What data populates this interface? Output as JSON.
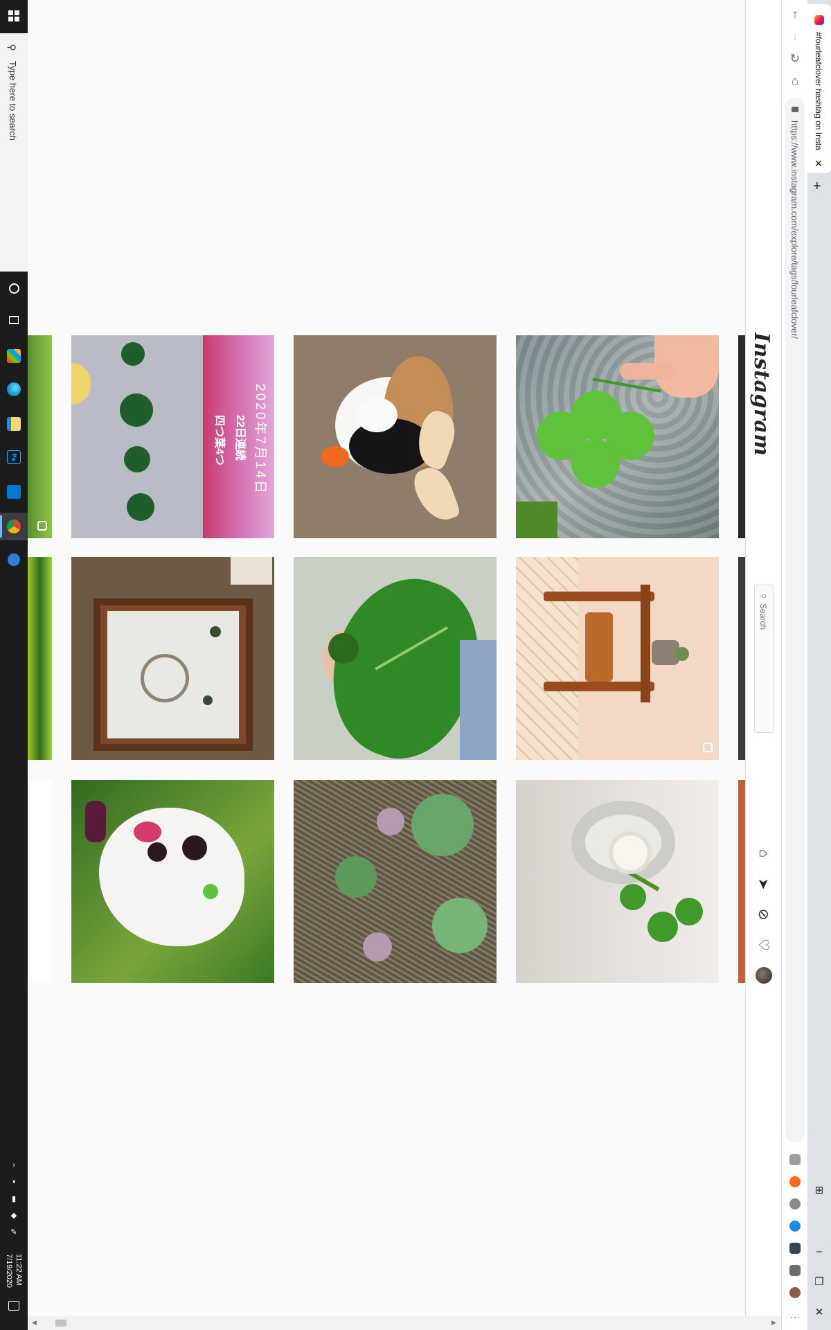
{
  "taskbar": {
    "search_placeholder": "Type here to search",
    "time": "11:22 AM",
    "date": "7/19/2020"
  },
  "browser": {
    "tab_title": "#fourleafclover hashtag on Insta",
    "url": "https://www.instagram.com/explore/tags/fourleafclover/"
  },
  "instagram": {
    "logo": "Instagram",
    "search_placeholder": "Search",
    "nav_icons": [
      "home-icon",
      "direct-icon",
      "explore-icon",
      "activity-icon",
      "profile-avatar"
    ]
  },
  "posts": [
    {
      "row": 1,
      "col": 1,
      "description_icon": "clover-garden",
      "multi": true
    },
    {
      "row": 1,
      "col": 2,
      "overlay_lines": [
        "2020年7月14日",
        "22日連続",
        "四つ葉4つ"
      ],
      "multi": false
    },
    {
      "row": 1,
      "col": 3,
      "description_icon": "corgi-dog",
      "multi": false
    },
    {
      "row": 1,
      "col": 4,
      "description_icon": "hand-holding-clover",
      "multi": false
    },
    {
      "row": 2,
      "col": 1,
      "description_icon": "green-plant",
      "multi": false
    },
    {
      "row": 2,
      "col": 2,
      "description_icon": "framed-pressed-clovers",
      "multi": false
    },
    {
      "row": 2,
      "col": 3,
      "description_icon": "hand-holding-leaf",
      "multi": false
    },
    {
      "row": 2,
      "col": 4,
      "description_icon": "table-with-plant",
      "multi": true
    },
    {
      "row": 3,
      "col": 2,
      "description_icon": "white-dog-with-clover",
      "multi": false
    },
    {
      "row": 3,
      "col": 3,
      "description_icon": "clover-patch",
      "multi": false
    },
    {
      "row": 3,
      "col": 4,
      "description_icon": "clover-in-vase",
      "multi": false
    }
  ],
  "colors": {
    "taskbar": "#1c1c1c",
    "page_bg": "#fafafa",
    "accent": "#0095f6"
  }
}
